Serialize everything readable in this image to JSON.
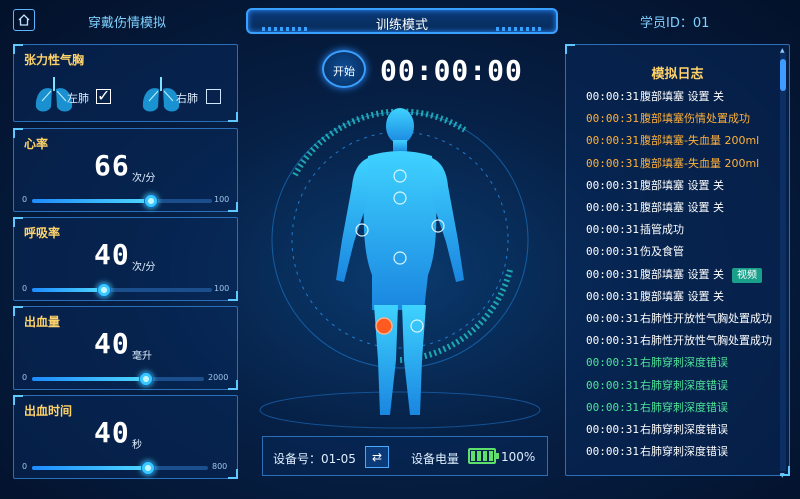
{
  "header": {
    "app_title": "穿戴伤情模拟",
    "mode_title": "训练模式",
    "student_id": "学员ID：01"
  },
  "pneumothorax": {
    "title": "张力性气胸",
    "left_label": "左肺",
    "left_checked": true,
    "right_label": "右肺",
    "right_checked": false
  },
  "heart_rate": {
    "title": "心率",
    "value": "66",
    "unit": "次/分",
    "min": "0",
    "max": "100",
    "level": 0.66
  },
  "respiration": {
    "title": "呼吸率",
    "value": "40",
    "unit": "次/分",
    "min": "0",
    "max": "100",
    "level": 0.4
  },
  "bleeding": {
    "title": "出血量",
    "value": "40",
    "unit": "毫升",
    "min": "0",
    "max": "2000",
    "level": 0.66
  },
  "bleed_time": {
    "title": "出血时间",
    "value": "40",
    "unit": "秒",
    "min": "0",
    "max": "800",
    "level": 0.66
  },
  "center": {
    "start_label": "开始",
    "timer": "00:00:00"
  },
  "device": {
    "device_label": "设备号：01-05",
    "swap_icon": "⇄",
    "battery_label": "设备电量",
    "battery_percent": "100%"
  },
  "log": {
    "title": "模拟日志",
    "video_label": "视频",
    "entries": [
      {
        "time": "00:00:31",
        "msg": "腹部填塞 设置 关",
        "color": "white"
      },
      {
        "time": "00:00:31",
        "msg": "腹部填塞伤情处置成功",
        "color": "orange"
      },
      {
        "time": "00:00:31",
        "msg": "腹部填塞-失血量 200ml",
        "color": "orange"
      },
      {
        "time": "00:00:31",
        "msg": "腹部填塞-失血量 200ml",
        "color": "orange"
      },
      {
        "time": "00:00:31",
        "msg": "腹部填塞 设置 关",
        "color": "white"
      },
      {
        "time": "00:00:31",
        "msg": "腹部填塞 设置 关",
        "color": "white"
      },
      {
        "time": "00:00:31",
        "msg": "插管成功",
        "color": "white"
      },
      {
        "time": "00:00:31",
        "msg": "伤及食管",
        "color": "white"
      },
      {
        "time": "00:00:31",
        "msg": "腹部填塞 设置 关",
        "color": "white",
        "video": true
      },
      {
        "time": "00:00:31",
        "msg": "腹部填塞 设置 关",
        "color": "white"
      },
      {
        "time": "00:00:31",
        "msg": "右肺性开放性气胸处置成功",
        "color": "white"
      },
      {
        "time": "00:00:31",
        "msg": "右肺性开放性气胸处置成功",
        "color": "white"
      },
      {
        "time": "00:00:31",
        "msg": "右肺穿刺深度错误",
        "color": "green"
      },
      {
        "time": "00:00:31",
        "msg": "右肺穿刺深度错误",
        "color": "green"
      },
      {
        "time": "00:00:31",
        "msg": "右肺穿刺深度错误",
        "color": "green"
      },
      {
        "time": "00:00:31",
        "msg": "右肺穿刺深度错误",
        "color": "white"
      },
      {
        "time": "00:00:31",
        "msg": "右肺穿刺深度错误",
        "color": "white"
      }
    ]
  },
  "colors": {
    "accent": "#3aa0ff",
    "title": "#ffd36a",
    "wound": "#ff5a1f",
    "log_orange": "#ffb13b",
    "log_green": "#4ee39a"
  }
}
